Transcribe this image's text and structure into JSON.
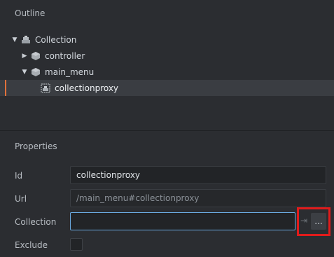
{
  "outline": {
    "title": "Outline",
    "items": [
      {
        "label": "Collection",
        "icon": "collection-icon",
        "expanded": true
      },
      {
        "label": "controller",
        "icon": "gameobject-icon",
        "expanded": false
      },
      {
        "label": "main_menu",
        "icon": "gameobject-icon",
        "expanded": true
      },
      {
        "label": "collectionproxy",
        "icon": "collectionproxy-icon",
        "selected": true
      }
    ]
  },
  "properties": {
    "title": "Properties",
    "id_label": "Id",
    "id_value": "collectionproxy",
    "url_label": "Url",
    "url_value": "/main_menu#collectionproxy",
    "collection_label": "Collection",
    "collection_value": "",
    "browse_label": "...",
    "goto_icon": "⇥",
    "exclude_label": "Exclude",
    "exclude_checked": false
  },
  "colors": {
    "accent_selection": "#e0713b",
    "focus_border": "#6aa9e0",
    "highlight": "#e11b1b"
  }
}
